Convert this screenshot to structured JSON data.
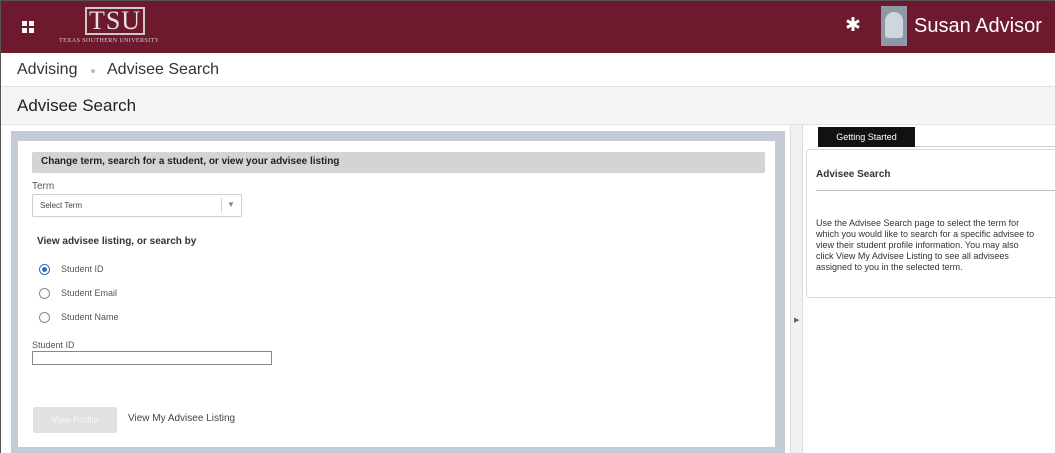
{
  "header": {
    "logo_text": "TSU",
    "logo_subtitle": "Texas Southern University",
    "user_name": "Susan Advisor",
    "colors": {
      "header_bg": "#6d1a2e",
      "text": "#ffffff"
    },
    "icons": {
      "apps": "apps-grid-icon",
      "settings": "gear-icon",
      "avatar": "user-avatar"
    }
  },
  "breadcrumb": {
    "items": [
      "Advising",
      "Advisee Search"
    ]
  },
  "page": {
    "title": "Advisee Search"
  },
  "form": {
    "section_title": "Change term, search for a student, or view your advisee listing",
    "term_label": "Term",
    "term_value": "Select Term",
    "search_by_label": "View advisee listing, or search by",
    "radios": [
      {
        "label": "Student ID",
        "checked": true
      },
      {
        "label": "Student Email",
        "checked": false
      },
      {
        "label": "Student Name",
        "checked": false
      }
    ],
    "student_id_label": "Student ID",
    "student_id_value": "",
    "view_profile_label": "View Profile",
    "listing_link_label": "View My Advisee Listing",
    "colors": {
      "radio_checked": "#2a6ec6",
      "panel_border": "#c3ccd6"
    }
  },
  "help_panel": {
    "tab_label": "Getting Started",
    "title": "Advisee Search",
    "text": "Use the Advisee Search page to select the term for\nwhich you would like to search for a specific advisee to\nview their student profile information. You may also\nclick View My Advisee Listing to see all advisees\nassigned to you in the selected term."
  }
}
